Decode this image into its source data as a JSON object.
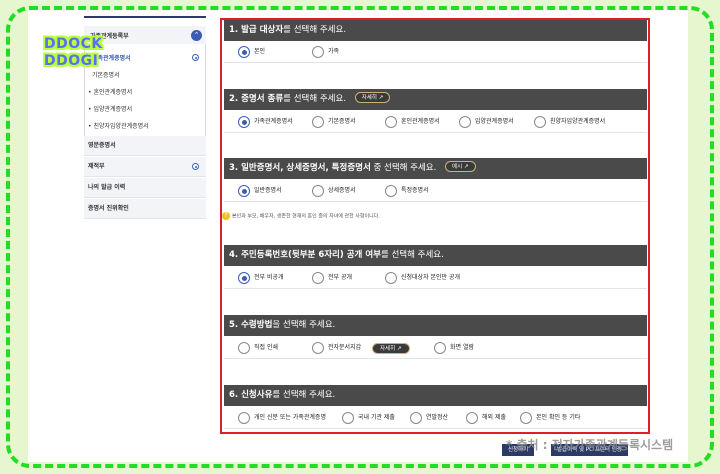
{
  "sidebar": {
    "group_title": "가족관계등록부",
    "items": [
      "가족관계증명서",
      "기본증명서",
      "혼인관계증명서",
      "입양관계증명서",
      "친양자입양관계증명서"
    ],
    "sections": [
      "영문증명서",
      "제적부",
      "나의 발급 이력",
      "증명서 진위확인"
    ]
  },
  "logo": {
    "line1": "DDOCK",
    "line2": "DDOGI"
  },
  "sections": {
    "s1": {
      "title_bold": "1. 발급 대상자",
      "title_rest": "를 선택해 주세요.",
      "options": [
        "본인",
        "가족"
      ]
    },
    "s2": {
      "title_bold": "2. 증명서 종류",
      "title_rest": "를 선택해 주세요.",
      "detail": "자세히 ↗",
      "options": [
        "가족관계증명서",
        "기본증명서",
        "혼인관계증명서",
        "입양관계증명서",
        "친양자입양관계증명서"
      ]
    },
    "s3": {
      "title_bold": "3. 일반증명서, 상세증명서, 특정증명서",
      "title_rest": " 중 선택해 주세요.",
      "detail": "예시 ↗",
      "options": [
        "일반증명서",
        "상세증명서",
        "특정증명서"
      ],
      "note": "본인과 부모, 배우자, 생존한 현재의 혼인 중의 자녀에 관한 사항이니다."
    },
    "s4": {
      "title_bold": "4. 주민등록번호(뒷부분 6자리) 공개 여부",
      "title_rest": "를 선택해 주세요.",
      "options": [
        "전부 비공개",
        "전부 공개",
        "신청대상자 본인만 공개"
      ]
    },
    "s5": {
      "title_bold": "5. 수령방법",
      "title_rest": "을 선택해 주세요.",
      "options": [
        "직접 인쇄",
        "전자문서지갑",
        "화면 열람"
      ],
      "detail": "자세히 ↗"
    },
    "s6": {
      "title_bold": "6. 신청사유",
      "title_rest": "를 선택해 주세요.",
      "options": [
        "개인 신분 또는 가족관계증명",
        "국내 기관 제출",
        "연말정산",
        "해외 제출",
        "본인 확인 등 기타"
      ]
    }
  },
  "bottom": {
    "btn1": "신청하기",
    "btn2": "발급이력 및 PC 프린터 인증"
  },
  "watermark": "* 출처 : 전자가족관계등록시스템"
}
